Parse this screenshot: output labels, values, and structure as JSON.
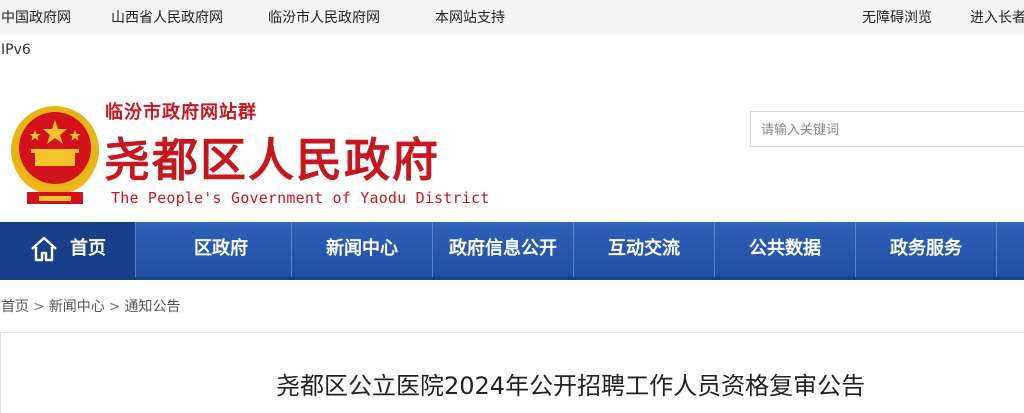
{
  "topbar": {
    "links": [
      "中国政府网",
      "山西省人民政府网",
      "临汾市人民政府网",
      "本网站支持"
    ],
    "right_links": [
      "无障碍浏览",
      "进入长者"
    ],
    "ipv6": "IPv6"
  },
  "header": {
    "group_name": "临汾市政府网站群",
    "title": "尧都区人民政府",
    "title_en": "The People's Government of Yaodu District",
    "search_placeholder": "请输入关键词",
    "colors": {
      "brand_red": "#c8161e",
      "nav_blue": "#2f61b9",
      "nav_dark": "#173f8a"
    }
  },
  "nav": {
    "home_icon": "home-icon",
    "items": [
      "首页",
      "区政府",
      "新闻中心",
      "政府信息公开",
      "互动交流",
      "公共数据",
      "政务服务"
    ]
  },
  "breadcrumb": [
    "首页",
    "新闻中心",
    "通知公告"
  ],
  "article": {
    "title": "尧都区公立医院2024年公开招聘工作人员资格复审公告"
  }
}
